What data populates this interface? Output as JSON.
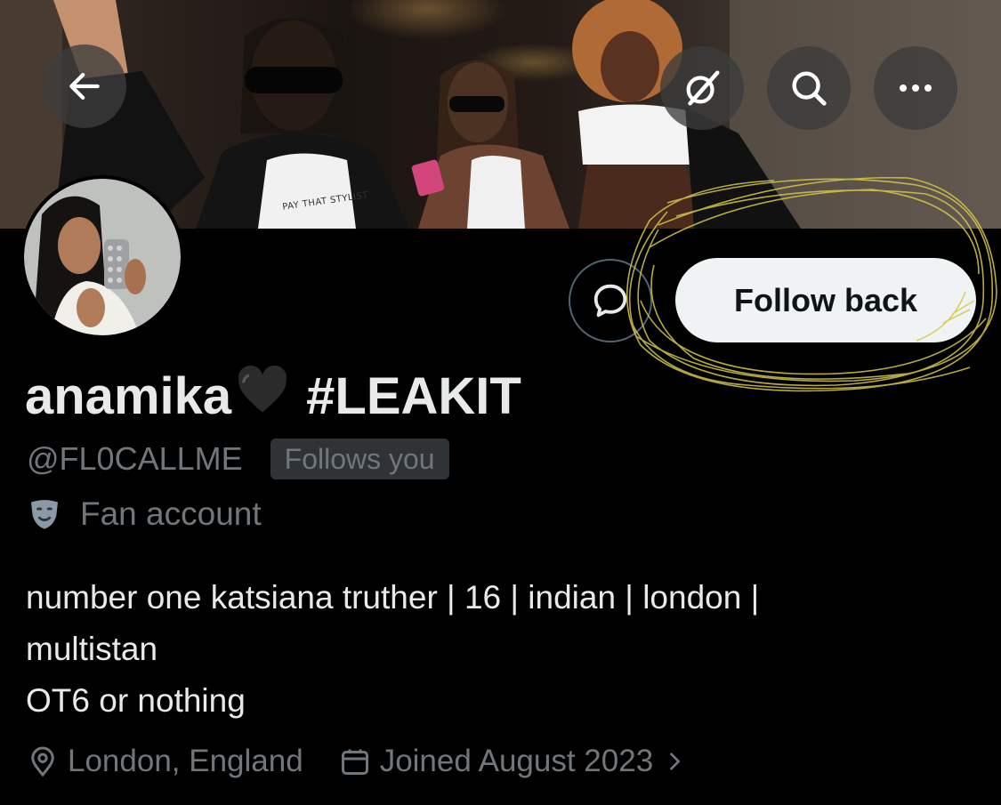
{
  "header": {
    "back_icon": "arrow-left-icon",
    "grok_icon": "grok-icon",
    "search_icon": "search-icon",
    "more_icon": "more-horizontal-icon"
  },
  "banner": {
    "shirt_text": "PAY THAT STYLIST"
  },
  "actions": {
    "message_icon": "message-bubble-icon",
    "follow_label": "Follow back"
  },
  "profile": {
    "display_name": "anamika",
    "display_name_emoji": "🖤",
    "hashtag": "#LEAKIT",
    "handle": "@FL0CALLME",
    "follows_you": "Follows you",
    "category_icon": "performing-arts-icon",
    "category": "Fan account",
    "bio_lines": [
      "number one katsiana truther | 16 | indian | london |",
      "multistan",
      "OT6 or nothing"
    ],
    "location_icon": "location-pin-icon",
    "location": "London, England",
    "joined_icon": "calendar-icon",
    "joined": "Joined August 2023"
  },
  "colors": {
    "background": "#000000",
    "primary_text": "#e7e9ea",
    "secondary_text": "#71767b",
    "follow_button_bg": "#eff3f4",
    "highlight_scribble": "#d6c84a"
  }
}
